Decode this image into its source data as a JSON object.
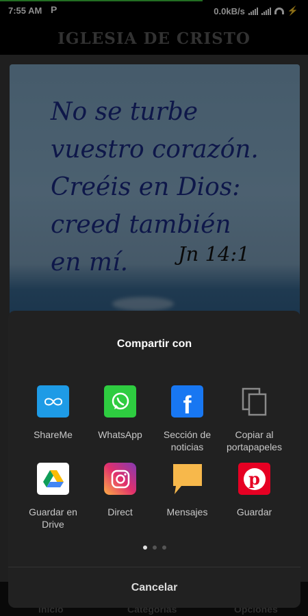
{
  "status_bar": {
    "time": "7:55 AM",
    "notification": "P",
    "net_speed": "0.0kB/s",
    "icons": [
      "signal-icon",
      "signal-icon",
      "wifi-icon",
      "charging-icon"
    ]
  },
  "app_bar": {
    "title": "IGLESIA DE CRISTO"
  },
  "verse": {
    "text": "No se turbe\nvuestro corazón.\nCreéis en Dios:\ncreed también\nen mí.",
    "reference": "Jn 14:1"
  },
  "bottom_nav": {
    "items": [
      {
        "label": "Inicio"
      },
      {
        "label": "Categorías"
      },
      {
        "label": "Opciones"
      }
    ]
  },
  "share_sheet": {
    "title": "Compartir con",
    "apps": [
      {
        "label": "ShareMe",
        "icon": "shareme-icon"
      },
      {
        "label": "WhatsApp",
        "icon": "whatsapp-icon"
      },
      {
        "label": "Sección de noticias",
        "icon": "facebook-icon"
      },
      {
        "label": "Copiar al portapapeles",
        "icon": "copy-icon"
      },
      {
        "label": "Guardar en Drive",
        "icon": "google-drive-icon"
      },
      {
        "label": "Direct",
        "icon": "instagram-icon"
      },
      {
        "label": "Mensajes",
        "icon": "messages-icon"
      },
      {
        "label": "Guardar",
        "icon": "pinterest-icon"
      }
    ],
    "page_count": 3,
    "active_page": 1,
    "cancel_label": "Cancelar"
  },
  "colors": {
    "verse_text": "#1b2a86",
    "sheet_background": "#212121",
    "whatsapp": "#2ecc40",
    "facebook": "#1877f2",
    "pinterest": "#e60023",
    "shareme": "#1e9be6"
  }
}
